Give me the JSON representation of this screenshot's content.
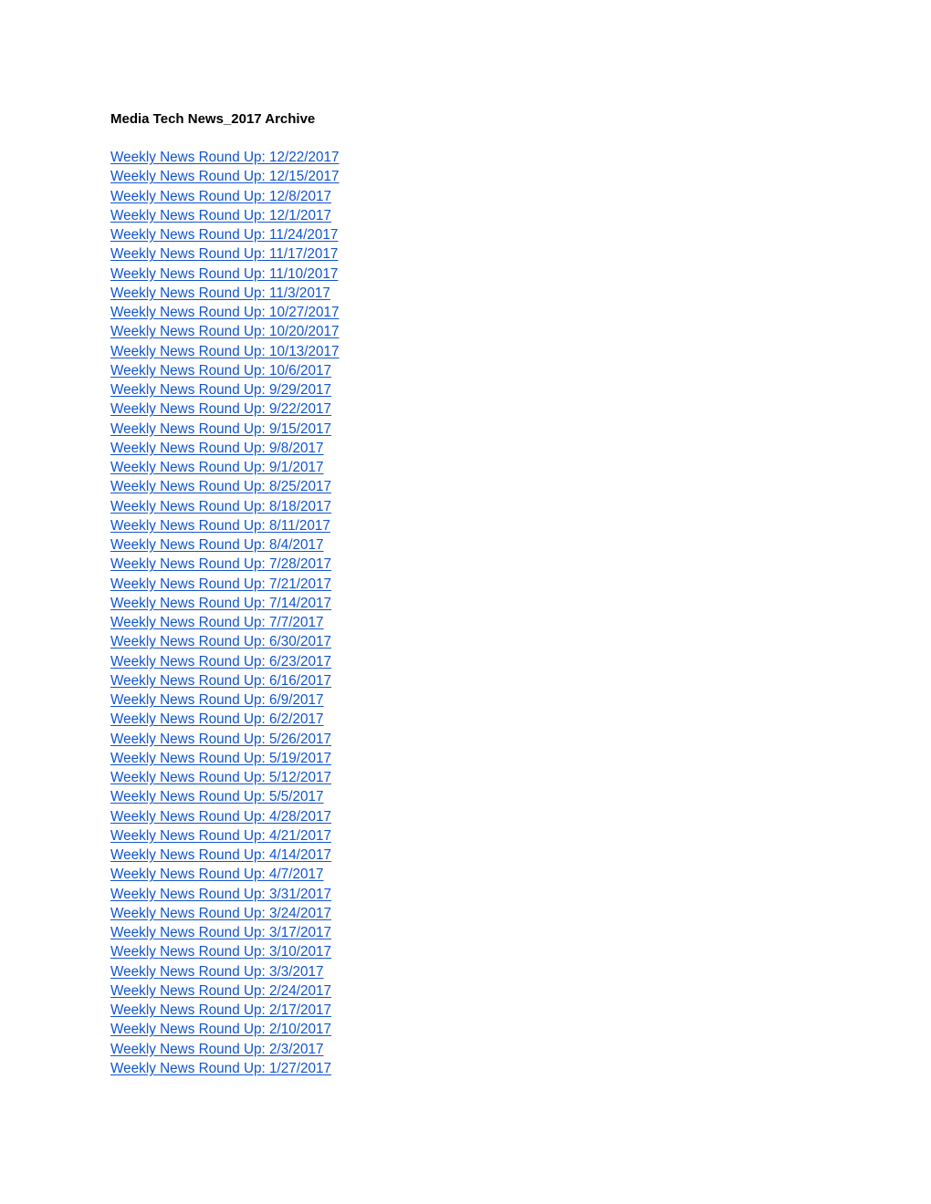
{
  "document": {
    "title": "Media Tech News_2017 Archive",
    "link_color": "#1155CC",
    "links": [
      {
        "label": "Weekly News Round Up: 12/22/2017"
      },
      {
        "label": "Weekly News Round Up: 12/15/2017"
      },
      {
        "label": "Weekly News Round Up: 12/8/2017"
      },
      {
        "label": "Weekly News Round Up: 12/1/2017"
      },
      {
        "label": "Weekly News Round Up: 11/24/2017"
      },
      {
        "label": "Weekly News Round Up: 11/17/2017"
      },
      {
        "label": "Weekly News Round Up: 11/10/2017"
      },
      {
        "label": "Weekly News Round Up: 11/3/2017"
      },
      {
        "label": "Weekly News Round Up: 10/27/2017"
      },
      {
        "label": "Weekly News Round Up: 10/20/2017"
      },
      {
        "label": "Weekly News Round Up: 10/13/2017"
      },
      {
        "label": "Weekly News Round Up: 10/6/2017"
      },
      {
        "label": "Weekly News Round Up: 9/29/2017"
      },
      {
        "label": "Weekly News Round Up: 9/22/2017"
      },
      {
        "label": "Weekly News Round Up: 9/15/2017"
      },
      {
        "label": "Weekly News Round Up: 9/8/2017"
      },
      {
        "label": "Weekly News Round Up: 9/1/2017"
      },
      {
        "label": "Weekly News Round Up: 8/25/2017"
      },
      {
        "label": "Weekly News Round Up: 8/18/2017"
      },
      {
        "label": "Weekly News Round Up: 8/11/2017"
      },
      {
        "label": "Weekly News Round Up: 8/4/2017"
      },
      {
        "label": "Weekly News Round Up: 7/28/2017"
      },
      {
        "label": "Weekly News Round Up: 7/21/2017"
      },
      {
        "label": "Weekly News Round Up: 7/14/2017"
      },
      {
        "label": "Weekly News Round Up: 7/7/2017"
      },
      {
        "label": "Weekly News Round Up: 6/30/2017"
      },
      {
        "label": "Weekly News Round Up: 6/23/2017"
      },
      {
        "label": "Weekly News Round Up: 6/16/2017"
      },
      {
        "label": "Weekly News Round Up: 6/9/2017"
      },
      {
        "label": "Weekly News Round Up: 6/2/2017"
      },
      {
        "label": "Weekly News Round Up: 5/26/2017"
      },
      {
        "label": "Weekly News Round Up: 5/19/2017"
      },
      {
        "label": "Weekly News Round Up: 5/12/2017"
      },
      {
        "label": "Weekly News Round Up: 5/5/2017"
      },
      {
        "label": "Weekly News Round Up: 4/28/2017"
      },
      {
        "label": "Weekly News Round Up: 4/21/2017"
      },
      {
        "label": "Weekly News Round Up: 4/14/2017"
      },
      {
        "label": "Weekly News Round Up: 4/7/2017"
      },
      {
        "label": "Weekly News Round Up: 3/31/2017"
      },
      {
        "label": "Weekly News Round Up: 3/24/2017"
      },
      {
        "label": "Weekly News Round Up: 3/17/2017"
      },
      {
        "label": "Weekly News Round Up: 3/10/2017"
      },
      {
        "label": "Weekly News Round Up: 3/3/2017"
      },
      {
        "label": "Weekly News Round Up: 2/24/2017"
      },
      {
        "label": "Weekly News Round Up: 2/17/2017"
      },
      {
        "label": "Weekly News Round Up: 2/10/2017"
      },
      {
        "label": "Weekly News Round Up: 2/3/2017"
      },
      {
        "label": "Weekly News Round Up: 1/27/2017"
      }
    ]
  }
}
